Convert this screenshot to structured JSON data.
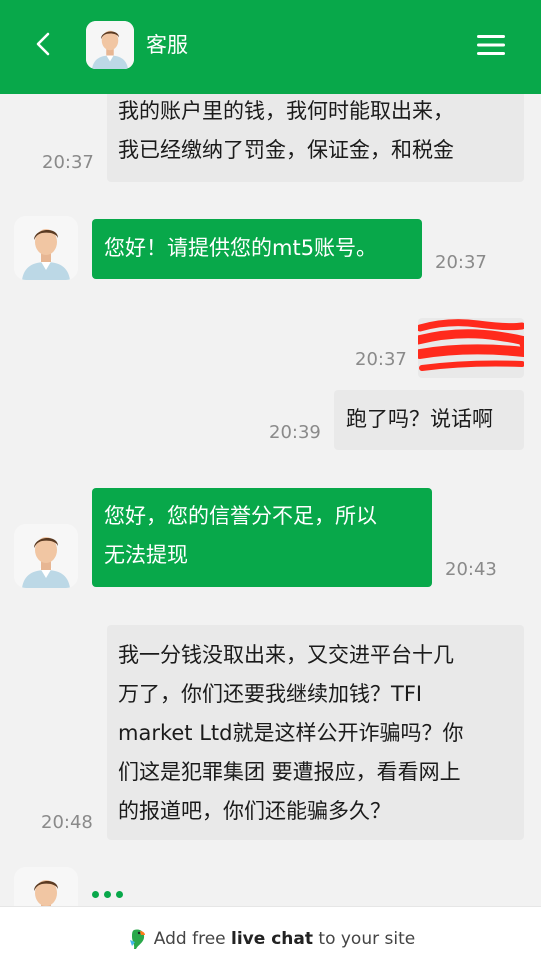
{
  "header": {
    "title": "客服",
    "back_icon": "chevron-left-icon",
    "menu_icon": "hamburger-menu-icon",
    "background_color": "#08a84a"
  },
  "messages": [
    {
      "sender": "visitor",
      "lines": [
        "我的账户里的钱，我何时能取出来，",
        "我已经缴纳了罚金，保证金，和税金"
      ],
      "time": "20:37"
    },
    {
      "sender": "agent",
      "lines": [
        "您好！请提供您的mt5账号。"
      ],
      "time": "20:37"
    },
    {
      "sender": "visitor",
      "lines": [],
      "time": "20:37",
      "redacted": true
    },
    {
      "sender": "visitor",
      "lines": [
        "跑了吗？说话啊"
      ],
      "time": "20:39"
    },
    {
      "sender": "agent",
      "lines": [
        "您好，您的信誉分不足，所以",
        "无法提现"
      ],
      "time": "20:43"
    },
    {
      "sender": "visitor",
      "lines": [
        "我一分钱没取出来，又交进平台十几",
        "万了，你们还要我继续加钱？TFI",
        "market Ltd就是这样公开诈骗吗？你",
        "们这是犯罪集团 要遭报应，看看网上",
        "的报道吧，你们还能骗多久？"
      ],
      "time": "20:48"
    }
  ],
  "typing_indicator": true,
  "footer": {
    "text_prefix": "Add free ",
    "text_bold": "live chat",
    "text_suffix": " to your site",
    "logo_icon": "livechat-parrot-icon"
  }
}
